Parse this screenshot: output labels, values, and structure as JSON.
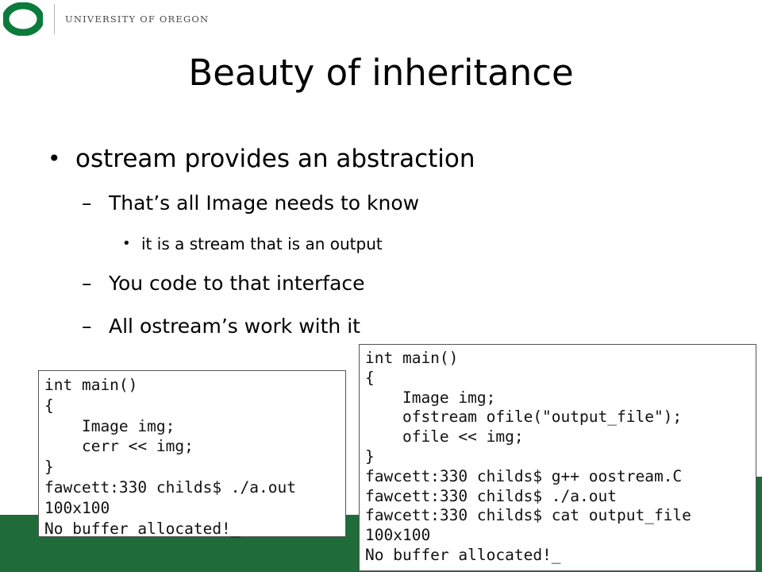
{
  "header": {
    "logo_text": "UNIVERSITY OF OREGON"
  },
  "slide": {
    "title": "Beauty of inheritance",
    "bullet_main": "ostream provides an abstraction",
    "sub1": "That’s all Image needs to know",
    "sub1_detail": "it is a stream that is an output",
    "sub2": "You code to that interface",
    "sub3": "All ostream’s work with it",
    "dash": "–",
    "bullet_char": "•"
  },
  "code_left": {
    "lines": [
      "int main()",
      "{",
      "    Image img;",
      "    cerr << img;",
      "}",
      "fawcett:330 childs$ ./a.out",
      "100x100",
      "No buffer allocated!_"
    ]
  },
  "code_right": {
    "lines": [
      "int main()",
      "{",
      "    Image img;",
      "    ofstream ofile(\"output_file\");",
      "    ofile << img;",
      "}",
      "fawcett:330 childs$ g++ oostream.C",
      "fawcett:330 childs$ ./a.out",
      "fawcett:330 childs$ cat output_file",
      "100x100",
      "No buffer allocated!_"
    ]
  },
  "colors": {
    "uo_green": "#1f6b3a",
    "uo_logo_green": "#0b7a3b"
  }
}
